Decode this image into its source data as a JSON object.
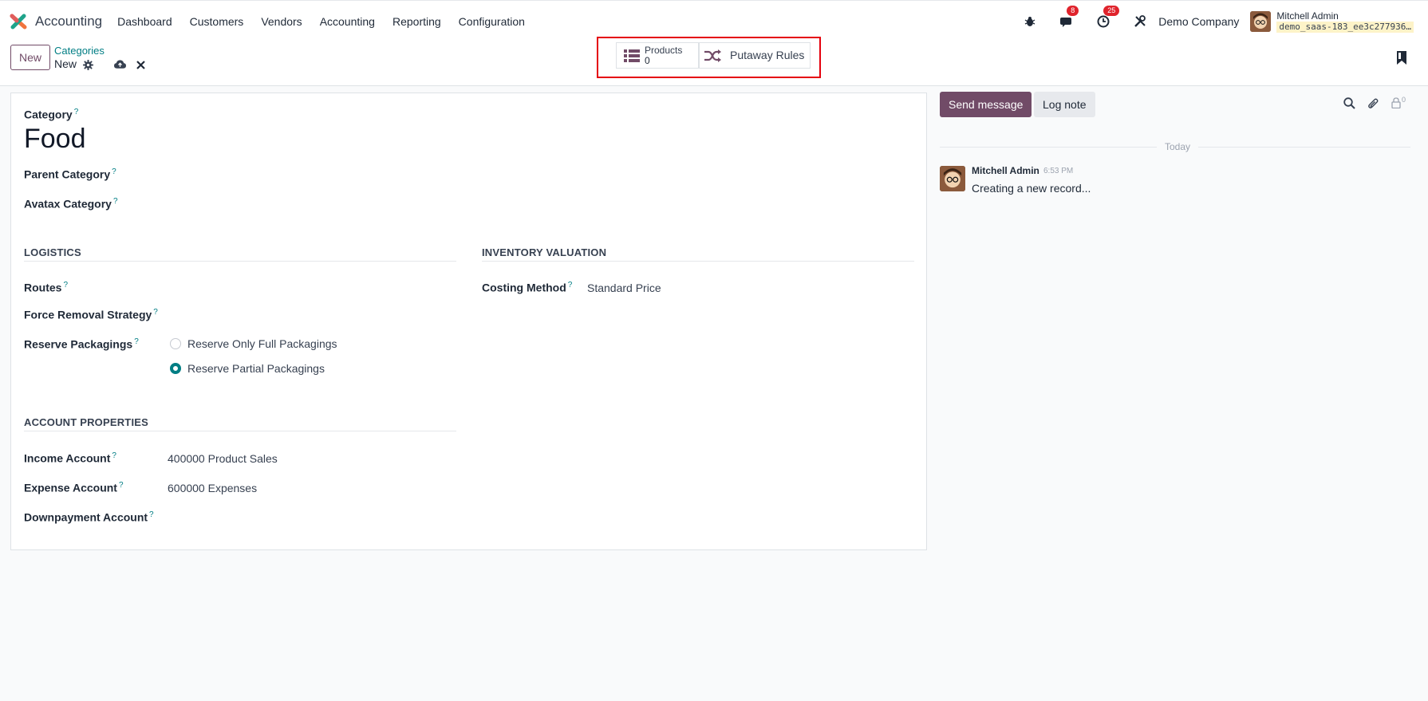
{
  "navbar": {
    "app_name": "Accounting",
    "menu": [
      "Dashboard",
      "Customers",
      "Vendors",
      "Accounting",
      "Reporting",
      "Configuration"
    ],
    "messages_count": "8",
    "activities_count": "25",
    "company": "Demo Company",
    "user_name": "Mitchell Admin",
    "db_name": "demo_saas-183_ee3c277936…"
  },
  "control": {
    "new_label": "New",
    "breadcrumb": "Categories",
    "record_name": "New",
    "smart_buttons": {
      "products_label": "Products",
      "products_count": "0",
      "putaway_label": "Putaway Rules"
    }
  },
  "form": {
    "category_label": "Category",
    "category_value": "Food",
    "parent_category_label": "Parent Category",
    "avatax_category_label": "Avatax Category",
    "logistics_title": "Logistics",
    "routes_label": "Routes",
    "force_removal_label": "Force Removal Strategy",
    "reserve_packagings_label": "Reserve Packagings",
    "reserve_options": [
      "Reserve Only Full Packagings",
      "Reserve Partial Packagings"
    ],
    "reserve_selected": "Reserve Partial Packagings",
    "inventory_valuation_title": "Inventory Valuation",
    "costing_method_label": "Costing Method",
    "costing_method_value": "Standard Price",
    "account_properties_title": "Account Properties",
    "income_account_label": "Income Account",
    "income_account_value": "400000 Product Sales",
    "expense_account_label": "Expense Account",
    "expense_account_value": "600000 Expenses",
    "downpayment_account_label": "Downpayment Account",
    "help_mark": "?"
  },
  "chatter": {
    "send_message": "Send message",
    "log_note": "Log note",
    "followers_count": "0",
    "date_separator": "Today",
    "message": {
      "author": "Mitchell Admin",
      "time": "6:53 PM",
      "body": "Creating a new record..."
    }
  },
  "colors": {
    "brand_purple": "#714b67",
    "teal": "#017e84",
    "badge_red": "#e0232c",
    "highlight_red": "#e5000d"
  }
}
